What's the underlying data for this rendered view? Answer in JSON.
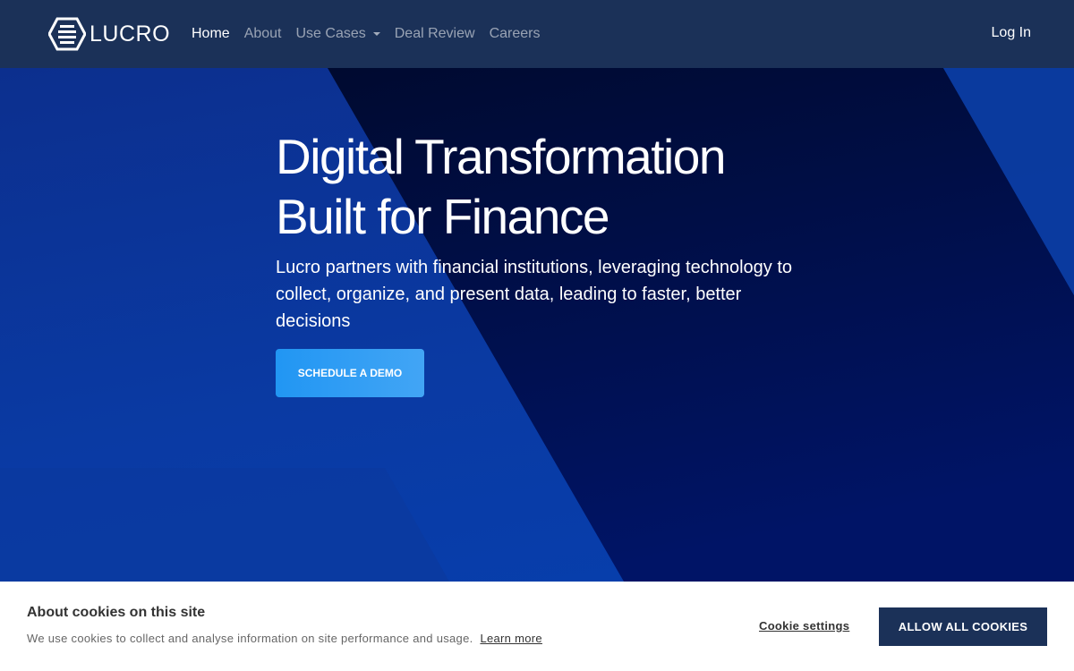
{
  "brand": {
    "name": "LUCRO"
  },
  "nav": {
    "items": [
      {
        "label": "Home",
        "active": true
      },
      {
        "label": "About"
      },
      {
        "label": "Use Cases",
        "dropdown": true
      },
      {
        "label": "Deal Review"
      },
      {
        "label": "Careers"
      }
    ],
    "login": "Log In"
  },
  "hero": {
    "title_line1": "Digital Transformation",
    "title_line2": "Built for Finance",
    "subtitle": "Lucro partners with financial institutions, leveraging technology to collect, organize, and present data, leading to faster, better decisions",
    "cta": "SCHEDULE A DEMO"
  },
  "cookie": {
    "title": "About cookies on this site",
    "text": "We use cookies to collect and analyse information on site performance and usage.",
    "learn_more": "Learn more",
    "settings": "Cookie settings",
    "allow": "ALLOW ALL COOKIES"
  },
  "colors": {
    "navbar": "#1b3158",
    "hero_dark": "#000d3a",
    "cta": "#2196f3",
    "cookie_button": "#1b3158"
  }
}
